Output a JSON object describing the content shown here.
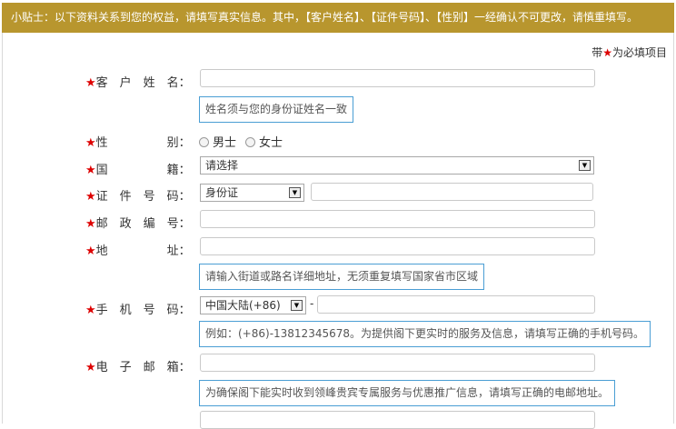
{
  "banner": {
    "text": "小贴士：以下资料关系到您的权益，请填写真实信息。其中，【客户姓名】、【证件号码】、【性别】一经确认不可更改，请慎重填写。"
  },
  "required_note": {
    "prefix": "带",
    "star": "★",
    "suffix": "为必填项目"
  },
  "fields": {
    "name": {
      "label": "客　户　姓　名：",
      "hint": "姓名须与您的身份证姓名一致"
    },
    "gender": {
      "label": "性　　　　　别：",
      "options": [
        "男士",
        "女士"
      ]
    },
    "nationality": {
      "label": "国　　　　　籍：",
      "selected": "请选择"
    },
    "id": {
      "label": "证　件　号　码：",
      "type_selected": "身份证"
    },
    "postcode": {
      "label": "邮　政　编　号："
    },
    "address": {
      "label": "地　　　　　址：",
      "hint": "请输入街道或路名详细地址，无须重复填写国家省市区域"
    },
    "mobile": {
      "label": "手　机　号　码：",
      "country_selected": "中国大陆(+86)",
      "separator": "-",
      "hint": "例如：(+86)-13812345678。为提供阁下更实时的服务及信息，请填写正确的手机号码。"
    },
    "email": {
      "label": "电　子　邮　箱：",
      "hint": "为确保阁下能实时收到领峰贵宾专属服务与优惠推广信息，请填写正确的电邮地址。"
    }
  },
  "star": "★",
  "icons": {
    "dropdown": "triangle-down"
  }
}
